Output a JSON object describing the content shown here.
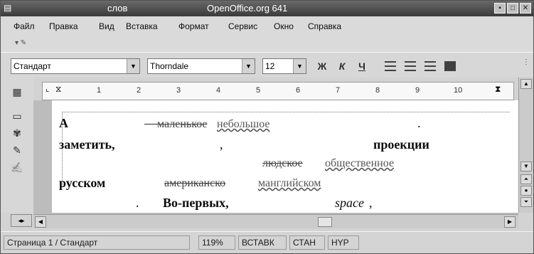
{
  "window": {
    "title_left": "слов",
    "title_app": "OpenOffice.org 641",
    "buttons": [
      "▪",
      "□",
      "✕"
    ]
  },
  "menu": {
    "items": [
      "Файл",
      "Правка",
      "Вид",
      "Вставка",
      "Формат",
      "Сервис",
      "Окно",
      "Справка"
    ]
  },
  "toolbar": {
    "style_value": "Стандарт",
    "font_value": "Thorndale",
    "size_value": "12",
    "bold_label": "Ж",
    "italic_label": "К",
    "underline_label": "Ч"
  },
  "ruler": {
    "ticks": [
      "1",
      "2",
      "3",
      "4",
      "5",
      "6",
      "7",
      "8",
      "9",
      "10"
    ]
  },
  "document": {
    "line1": {
      "a": "А",
      "dash": "—",
      "strike": "маленькое",
      "under": "небольшое",
      "dot": "."
    },
    "line2": {
      "a": "заметить,",
      "b": ",",
      "c": "проекции"
    },
    "line3": {
      "strike": "людское",
      "under": "общественное"
    },
    "line4": {
      "a": "русском",
      "strike": "американско",
      "under": "манглийском"
    },
    "line5": {
      "dot": ".",
      "a": "Во-первых,",
      "b": "space",
      "c": ","
    }
  },
  "status": {
    "page": "Страница  1 / Стандарт",
    "zoom": "119%",
    "insert": "ВСТАВК",
    "std": "СТАН",
    "hyp": "HYP"
  }
}
